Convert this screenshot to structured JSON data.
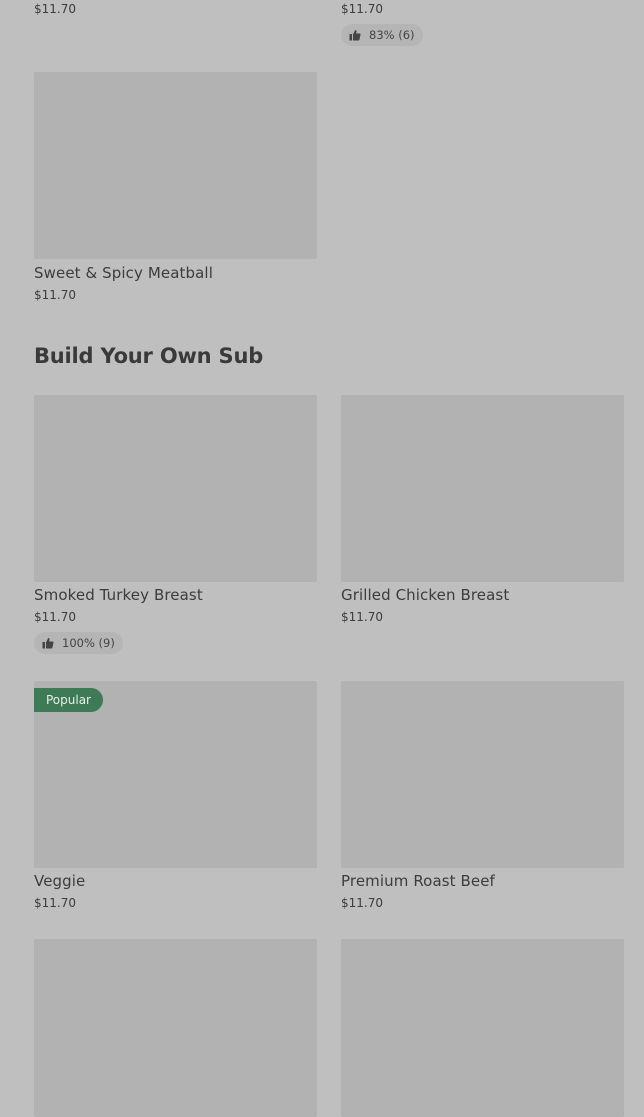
{
  "top_row": {
    "left": {
      "price": "$11.70"
    },
    "right": {
      "price": "$11.70",
      "rating": "83% (6)"
    }
  },
  "featured": [
    {
      "title": "Sweet & Spicy Meatball",
      "price": "$11.70"
    }
  ],
  "section": {
    "title": "Build Your Own Sub",
    "items": [
      {
        "title": "Smoked Turkey Breast",
        "price": "$11.70",
        "rating": "100% (9)"
      },
      {
        "title": "Grilled Chicken Breast",
        "price": "$11.70"
      },
      {
        "title": "Veggie",
        "price": "$11.70",
        "badge": "Popular"
      },
      {
        "title": "Premium Roast Beef",
        "price": "$11.70"
      }
    ]
  },
  "icons": {
    "rating": "thumbs-up-icon"
  },
  "colors": {
    "background": "#bfbfbf",
    "image_placeholder": "#b2b2b2",
    "badge": "#3f7a57"
  }
}
